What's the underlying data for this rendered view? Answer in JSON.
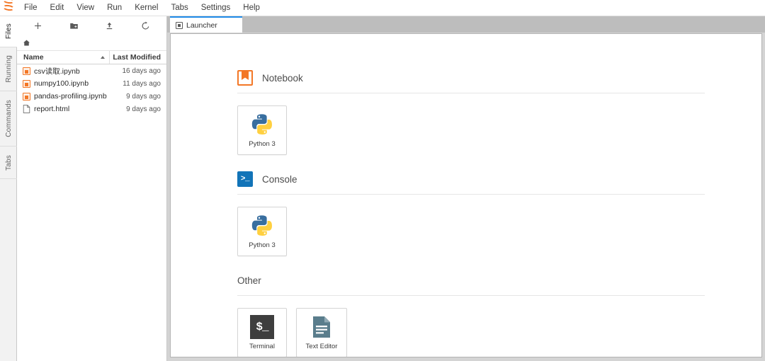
{
  "app": {
    "logo_icon": "jupyter-logo"
  },
  "menubar": {
    "items": [
      {
        "label": "File"
      },
      {
        "label": "Edit"
      },
      {
        "label": "View"
      },
      {
        "label": "Run"
      },
      {
        "label": "Kernel"
      },
      {
        "label": "Tabs"
      },
      {
        "label": "Settings"
      },
      {
        "label": "Help"
      }
    ]
  },
  "activity_bar": {
    "items": [
      {
        "label": "Files",
        "active": true
      },
      {
        "label": "Running",
        "active": false
      },
      {
        "label": "Commands",
        "active": false
      },
      {
        "label": "Tabs",
        "active": false
      }
    ]
  },
  "file_browser": {
    "toolbar": [
      {
        "icon": "plus-icon",
        "title": "New Launcher"
      },
      {
        "icon": "new-folder-icon",
        "title": "New Folder"
      },
      {
        "icon": "upload-icon",
        "title": "Upload"
      },
      {
        "icon": "refresh-icon",
        "title": "Refresh"
      }
    ],
    "breadcrumb": {
      "icon": "home-icon"
    },
    "columns": {
      "name": "Name",
      "last_modified": "Last Modified",
      "sort_icon": "sort-ascending-icon"
    },
    "files": [
      {
        "name": "csv读取.ipynb",
        "modified": "16 days ago",
        "icon": "notebook-file-icon"
      },
      {
        "name": "numpy100.ipynb",
        "modified": "11 days ago",
        "icon": "notebook-file-icon"
      },
      {
        "name": "pandas-profiling.ipynb",
        "modified": "9 days ago",
        "icon": "notebook-file-icon"
      },
      {
        "name": "report.html",
        "modified": "9 days ago",
        "icon": "html-file-icon"
      }
    ]
  },
  "dock": {
    "tabs": [
      {
        "label": "Launcher",
        "icon": "launcher-icon",
        "active": true
      }
    ]
  },
  "launcher": {
    "sections": [
      {
        "title": "Notebook",
        "icon": "notebook-icon",
        "cards": [
          {
            "label": "Python 3",
            "icon": "python-logo"
          }
        ]
      },
      {
        "title": "Console",
        "icon": "console-icon",
        "cards": [
          {
            "label": "Python 3",
            "icon": "python-logo"
          }
        ]
      },
      {
        "title": "Other",
        "icon": "",
        "cards": [
          {
            "label": "Terminal",
            "icon": "terminal-icon"
          },
          {
            "label": "Text Editor",
            "icon": "text-editor-icon"
          }
        ]
      }
    ]
  },
  "colors": {
    "jupyter_orange": "#f37726",
    "console_blue": "#1274b8",
    "tab_active_border": "#1e8ae8",
    "terminal_dark": "#3e3e3e",
    "text_editor_teal": "#5a7d8c"
  }
}
